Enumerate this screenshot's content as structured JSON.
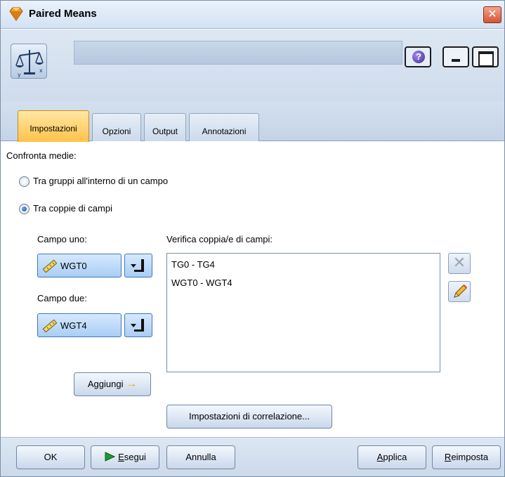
{
  "window": {
    "title": "Paired Means",
    "close_symbol": "✕"
  },
  "header": {
    "node_icon": "balance-scale-icon",
    "node_name": "",
    "help_symbol": "?"
  },
  "tabs": [
    {
      "label": "Impostazioni",
      "active": true
    },
    {
      "label": "Opzioni",
      "active": false
    },
    {
      "label": "Output",
      "active": false
    },
    {
      "label": "Annotazioni",
      "active": false
    }
  ],
  "settings": {
    "compare_label": "Confronta medie:",
    "radio_groups_label": "Tra gruppi all'interno di un campo",
    "radio_pairs_label": "Tra coppie di campi",
    "selected_mode": "pairs",
    "field_one_label": "Campo uno:",
    "field_one_value": "WGT0",
    "field_two_label": "Campo due:",
    "field_two_value": "WGT4",
    "pairs_label": "Verifica coppia/e di campi:",
    "pairs": [
      "TG0 - TG4",
      "WGT0 - WGT4"
    ],
    "add_button": "Aggiungi",
    "add_arrow": "→",
    "correlation_button": "Impostazioni di correlazione..."
  },
  "buttons": {
    "ok": "OK",
    "run_first": "E",
    "run_rest": "segui",
    "cancel": "Annulla",
    "apply_first": "A",
    "apply_rest": "pplica",
    "reset_first": "R",
    "reset_rest": "eimposta"
  },
  "colors": {
    "active_tab": "#ffc24b",
    "field_combo": "#a9cdf5",
    "run_icon": "#1e9a2e"
  }
}
